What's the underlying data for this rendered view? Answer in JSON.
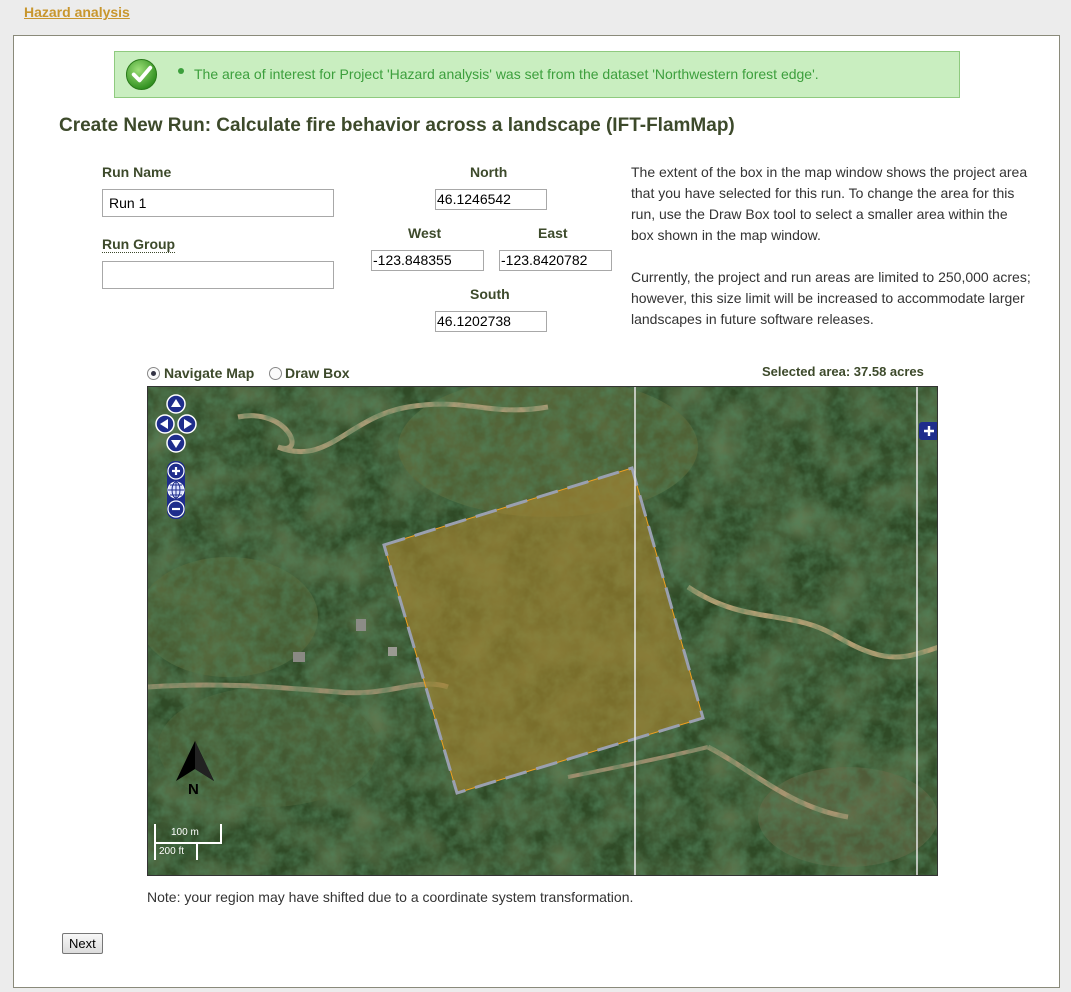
{
  "breadcrumb": "Hazard analysis",
  "alert": {
    "message": "The area of interest for Project 'Hazard analysis' was set from the dataset 'Northwestern forest edge'."
  },
  "title": "Create New Run: Calculate fire behavior across a landscape (IFT-FlamMap)",
  "form": {
    "run_name_label": "Run Name",
    "run_name_value": "Run 1",
    "run_group_label": "Run Group",
    "run_group_value": "",
    "north_label": "North",
    "north_value": "46.1246542",
    "west_label": "West",
    "west_value": "-123.848355",
    "east_label": "East",
    "east_value": "-123.8420782",
    "south_label": "South",
    "south_value": "46.1202738"
  },
  "help": {
    "paragraph1": "The extent of the box in the map window shows the project area that you have selected for this run. To change the area for this run, use the Draw Box tool to select a smaller area within the box shown in the map window.",
    "paragraph2": "Currently, the project and run areas are limited to 250,000 acres; however, this size limit will be increased to accommodate larger landscapes in future software releases."
  },
  "map_tools": {
    "navigate_label": "Navigate Map",
    "draw_label": "Draw Box",
    "selected_mode": "Navigate Map",
    "selected_area": "Selected area: 37.58 acres"
  },
  "map": {
    "north_arrow_label": "N",
    "scale_metric": "100 m",
    "scale_imperial": "200 ft",
    "box_fill_color": "#a8852e",
    "box_edge_color": "#f0a020",
    "box_dash_color": "#9aa0b0",
    "control_color": "#1f2d8c"
  },
  "note": "Note: your region may have shifted due to a coordinate system transformation.",
  "next_button": "Next"
}
